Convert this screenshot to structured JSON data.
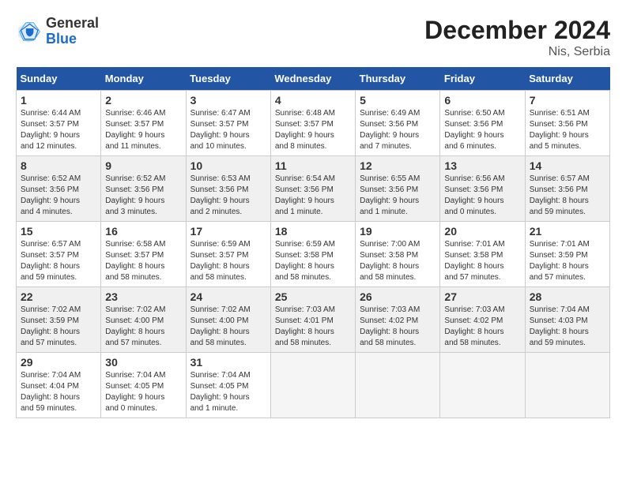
{
  "logo": {
    "general": "General",
    "blue": "Blue"
  },
  "title": "December 2024",
  "location": "Nis, Serbia",
  "days_header": [
    "Sunday",
    "Monday",
    "Tuesday",
    "Wednesday",
    "Thursday",
    "Friday",
    "Saturday"
  ],
  "weeks": [
    [
      {
        "num": "1",
        "info": "Sunrise: 6:44 AM\nSunset: 3:57 PM\nDaylight: 9 hours\nand 12 minutes."
      },
      {
        "num": "2",
        "info": "Sunrise: 6:46 AM\nSunset: 3:57 PM\nDaylight: 9 hours\nand 11 minutes."
      },
      {
        "num": "3",
        "info": "Sunrise: 6:47 AM\nSunset: 3:57 PM\nDaylight: 9 hours\nand 10 minutes."
      },
      {
        "num": "4",
        "info": "Sunrise: 6:48 AM\nSunset: 3:57 PM\nDaylight: 9 hours\nand 8 minutes."
      },
      {
        "num": "5",
        "info": "Sunrise: 6:49 AM\nSunset: 3:56 PM\nDaylight: 9 hours\nand 7 minutes."
      },
      {
        "num": "6",
        "info": "Sunrise: 6:50 AM\nSunset: 3:56 PM\nDaylight: 9 hours\nand 6 minutes."
      },
      {
        "num": "7",
        "info": "Sunrise: 6:51 AM\nSunset: 3:56 PM\nDaylight: 9 hours\nand 5 minutes."
      }
    ],
    [
      {
        "num": "8",
        "info": "Sunrise: 6:52 AM\nSunset: 3:56 PM\nDaylight: 9 hours\nand 4 minutes."
      },
      {
        "num": "9",
        "info": "Sunrise: 6:52 AM\nSunset: 3:56 PM\nDaylight: 9 hours\nand 3 minutes."
      },
      {
        "num": "10",
        "info": "Sunrise: 6:53 AM\nSunset: 3:56 PM\nDaylight: 9 hours\nand 2 minutes."
      },
      {
        "num": "11",
        "info": "Sunrise: 6:54 AM\nSunset: 3:56 PM\nDaylight: 9 hours\nand 1 minute."
      },
      {
        "num": "12",
        "info": "Sunrise: 6:55 AM\nSunset: 3:56 PM\nDaylight: 9 hours\nand 1 minute."
      },
      {
        "num": "13",
        "info": "Sunrise: 6:56 AM\nSunset: 3:56 PM\nDaylight: 9 hours\nand 0 minutes."
      },
      {
        "num": "14",
        "info": "Sunrise: 6:57 AM\nSunset: 3:56 PM\nDaylight: 8 hours\nand 59 minutes."
      }
    ],
    [
      {
        "num": "15",
        "info": "Sunrise: 6:57 AM\nSunset: 3:57 PM\nDaylight: 8 hours\nand 59 minutes."
      },
      {
        "num": "16",
        "info": "Sunrise: 6:58 AM\nSunset: 3:57 PM\nDaylight: 8 hours\nand 58 minutes."
      },
      {
        "num": "17",
        "info": "Sunrise: 6:59 AM\nSunset: 3:57 PM\nDaylight: 8 hours\nand 58 minutes."
      },
      {
        "num": "18",
        "info": "Sunrise: 6:59 AM\nSunset: 3:58 PM\nDaylight: 8 hours\nand 58 minutes."
      },
      {
        "num": "19",
        "info": "Sunrise: 7:00 AM\nSunset: 3:58 PM\nDaylight: 8 hours\nand 58 minutes."
      },
      {
        "num": "20",
        "info": "Sunrise: 7:01 AM\nSunset: 3:58 PM\nDaylight: 8 hours\nand 57 minutes."
      },
      {
        "num": "21",
        "info": "Sunrise: 7:01 AM\nSunset: 3:59 PM\nDaylight: 8 hours\nand 57 minutes."
      }
    ],
    [
      {
        "num": "22",
        "info": "Sunrise: 7:02 AM\nSunset: 3:59 PM\nDaylight: 8 hours\nand 57 minutes."
      },
      {
        "num": "23",
        "info": "Sunrise: 7:02 AM\nSunset: 4:00 PM\nDaylight: 8 hours\nand 57 minutes."
      },
      {
        "num": "24",
        "info": "Sunrise: 7:02 AM\nSunset: 4:00 PM\nDaylight: 8 hours\nand 58 minutes."
      },
      {
        "num": "25",
        "info": "Sunrise: 7:03 AM\nSunset: 4:01 PM\nDaylight: 8 hours\nand 58 minutes."
      },
      {
        "num": "26",
        "info": "Sunrise: 7:03 AM\nSunset: 4:02 PM\nDaylight: 8 hours\nand 58 minutes."
      },
      {
        "num": "27",
        "info": "Sunrise: 7:03 AM\nSunset: 4:02 PM\nDaylight: 8 hours\nand 58 minutes."
      },
      {
        "num": "28",
        "info": "Sunrise: 7:04 AM\nSunset: 4:03 PM\nDaylight: 8 hours\nand 59 minutes."
      }
    ],
    [
      {
        "num": "29",
        "info": "Sunrise: 7:04 AM\nSunset: 4:04 PM\nDaylight: 8 hours\nand 59 minutes."
      },
      {
        "num": "30",
        "info": "Sunrise: 7:04 AM\nSunset: 4:05 PM\nDaylight: 9 hours\nand 0 minutes."
      },
      {
        "num": "31",
        "info": "Sunrise: 7:04 AM\nSunset: 4:05 PM\nDaylight: 9 hours\nand 1 minute."
      },
      null,
      null,
      null,
      null
    ]
  ]
}
